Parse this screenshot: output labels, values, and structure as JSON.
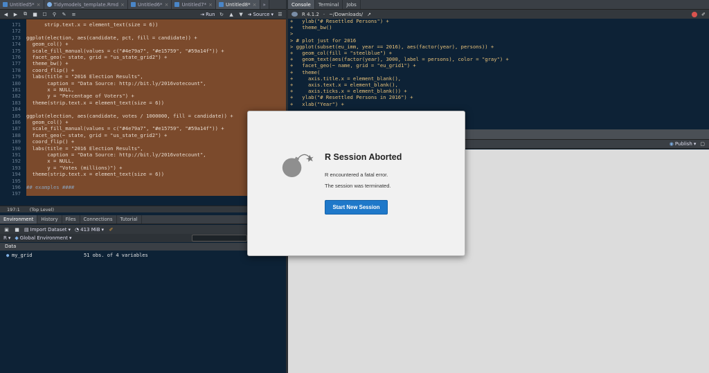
{
  "editor": {
    "tabs": [
      {
        "label": "Untitled5*",
        "close": "×"
      },
      {
        "label": "Tidymodels_template.Rmd",
        "close": "×"
      },
      {
        "label": "Untitled6*",
        "close": "×"
      },
      {
        "label": "Untitled7*",
        "close": "×"
      },
      {
        "label": "Untitled8*",
        "close": "×"
      }
    ],
    "more_tabs": "»",
    "run_label": "Run",
    "source_label": "Source",
    "lines": [
      {
        "n": "171",
        "text": "      strip.text.x = element_text(size = 6))"
      },
      {
        "n": "172",
        "text": ""
      },
      {
        "n": "173",
        "text": "ggplot(election, aes(candidate, pct, fill = candidate)) +"
      },
      {
        "n": "174",
        "text": "  geom_col() +"
      },
      {
        "n": "175",
        "text": "  scale_fill_manual(values = c(\"#4e79a7\", \"#e15759\", \"#59a14f\")) +"
      },
      {
        "n": "176",
        "text": "  facet_geo(~ state, grid = \"us_state_grid2\") +"
      },
      {
        "n": "177",
        "text": "  theme_bw() +"
      },
      {
        "n": "178",
        "text": "  coord_flip() +"
      },
      {
        "n": "179",
        "text": "  labs(title = \"2016 Election Results\","
      },
      {
        "n": "180",
        "text": "       caption = \"Data Source: http://bit.ly/2016votecount\","
      },
      {
        "n": "181",
        "text": "       x = NULL,"
      },
      {
        "n": "182",
        "text": "       y = \"Percentage of Voters\") +"
      },
      {
        "n": "183",
        "text": "  theme(strip.text.x = element_text(size = 6))"
      },
      {
        "n": "184",
        "text": ""
      },
      {
        "n": "185",
        "text": "ggplot(election, aes(candidate, votes / 1000000, fill = candidate)) +"
      },
      {
        "n": "186",
        "text": "  geom_col() +"
      },
      {
        "n": "187",
        "text": "  scale_fill_manual(values = c(\"#4e79a7\", \"#e15759\", \"#59a14f\")) +"
      },
      {
        "n": "188",
        "text": "  facet_geo(~ state, grid = \"us_state_grid2\") +"
      },
      {
        "n": "189",
        "text": "  coord_flip() +"
      },
      {
        "n": "190",
        "text": "  labs(title = \"2016 Election Results\","
      },
      {
        "n": "191",
        "text": "       caption = \"Data Source: http://bit.ly/2016votecount\","
      },
      {
        "n": "192",
        "text": "       x = NULL,"
      },
      {
        "n": "193",
        "text": "       y = \"Votes (millions)\") +"
      },
      {
        "n": "194",
        "text": "  theme(strip.text.x = element_text(size = 6))"
      },
      {
        "n": "195",
        "text": ""
      },
      {
        "n": "196",
        "text": "## examples ####"
      },
      {
        "n": "197",
        "text": ""
      }
    ],
    "status_position": "197:1",
    "status_scope": "(Top Level)"
  },
  "environment": {
    "tabs": [
      "Environment",
      "History",
      "Files",
      "Connections",
      "Tutorial"
    ],
    "import_label": "Import Dataset",
    "memory_label": "413 MiB",
    "r_label": "R",
    "scope_label": "Global Environment",
    "section_label": "Data",
    "rows": [
      {
        "name": "my_grid",
        "value": "51 obs. of 4 variables"
      }
    ]
  },
  "console": {
    "tabs": [
      "Console",
      "Terminal",
      "Jobs"
    ],
    "version_label": "R 4.1.2",
    "path_label": "~/Downloads/",
    "lines": [
      "+   ylab(\"# Resettled Persons\") +",
      "+   theme_bw()",
      ">",
      "> # plot just for 2016",
      "> ggplot(subset(eu_imm, year == 2016), aes(factor(year), persons)) +",
      "+   geom_col(fill = \"steelblue\") +",
      "+   geom_text(aes(factor(year), 3000, label = persons), color = \"gray\") +",
      "+   facet_geo(~ name, grid = \"eu_grid1\") +",
      "+   theme(",
      "+     axis.title.x = element_blank(),",
      "+     axis.text.x = element_blank(),",
      "+     axis.ticks.x = element_blank()) +",
      "+   ylab(\"# Resettled Persons in 2016\") +",
      "+   xlab(\"Year\") +"
    ]
  },
  "viewer": {
    "publish_label": "Publish"
  },
  "modal": {
    "title": "R Session Aborted",
    "line1": "R encountered a fatal error.",
    "line2": "The session was terminated.",
    "button": "Start New Session"
  },
  "colors": {
    "editor_bg": "#0d2236",
    "selection": "#7b4a2c",
    "console_text": "#e9c27a",
    "button_blue": "#1f78c9"
  }
}
